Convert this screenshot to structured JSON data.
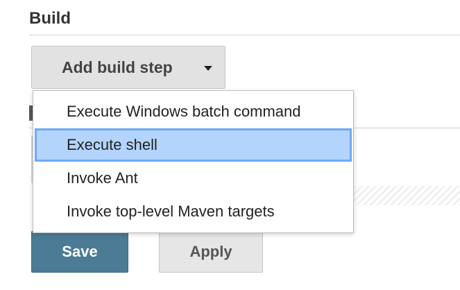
{
  "section": {
    "title": "Build"
  },
  "add_build_step": {
    "label": "Add build step",
    "icon": "caret-down-icon"
  },
  "dropdown": {
    "items": [
      {
        "label": "Execute Windows batch command",
        "selected": false
      },
      {
        "label": "Execute shell",
        "selected": true
      },
      {
        "label": "Invoke Ant",
        "selected": false
      },
      {
        "label": "Invoke top-level Maven targets",
        "selected": false
      }
    ],
    "highlight_color": "#b3d4fc"
  },
  "footer": {
    "save_label": "Save",
    "apply_label": "Apply",
    "save_color": "#4c7b96"
  }
}
